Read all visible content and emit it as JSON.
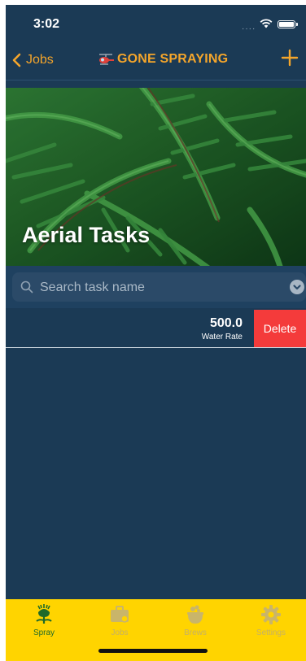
{
  "status_bar": {
    "time": "3:02",
    "signal": "····"
  },
  "nav": {
    "back_label": "Jobs",
    "title": "GONE SPRAYING"
  },
  "hero": {
    "title": "Aerial Tasks"
  },
  "search": {
    "placeholder": "Search task name",
    "value": ""
  },
  "tasks": [
    {
      "rate_value": "500.0",
      "rate_label": "Water Rate",
      "delete_label": "Delete"
    }
  ],
  "tabs": [
    {
      "label": "Spray",
      "active": true
    },
    {
      "label": "Jobs",
      "active": false
    },
    {
      "label": "Brews",
      "active": false
    },
    {
      "label": "Settings",
      "active": false
    }
  ],
  "colors": {
    "accent_orange": "#f4a52b",
    "background_navy": "#1b3a55",
    "tabbar_yellow": "#ffd400",
    "delete_red": "#f43b3b",
    "active_tab_green": "#1f6a2a"
  }
}
